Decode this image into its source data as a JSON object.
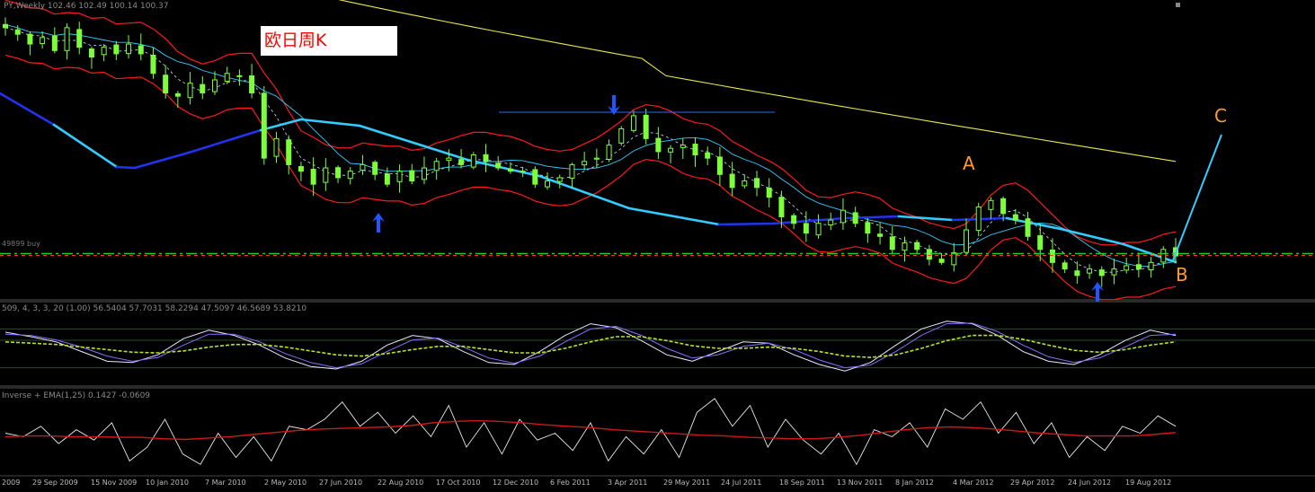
{
  "main_header": "PY,Weekly  102.46 102.49 100.14 100.37",
  "caption": "欧日周K",
  "hline_label": "49899 buy",
  "wave_labels": {
    "a": "A",
    "b": "B",
    "c": "C"
  },
  "stoch_header": "509, 4, 3, 3, 20 (1.00) 56.5404 57.7031 58.2294 47.5097 46.5689 53.8210",
  "inverse_header": "Inverse + EMA(1,25) 0.1427 -0.0609",
  "colors": {
    "background": "#000000",
    "bull_candle": "#7cff3a",
    "ma_cyan": "#33ccff",
    "ma_blue": "#2233ee",
    "ma_yellow": "#e6e64d",
    "band_red": "#ff1a1a",
    "arrow_blue": "#2255ff",
    "wave_label": "#ff9a33",
    "grid": "#2a3a2a"
  },
  "chart_data": [
    {
      "type": "candlestick",
      "title": "",
      "timeframe": "Weekly",
      "x_tick_labels": [
        "2009",
        "29 Sep 2009",
        "15 Nov 2009",
        "10 Jan 2010",
        "7 Mar 2010",
        "2 May 2010",
        "27 Jun 2010",
        "22 Aug 2010",
        "17 Oct 2010",
        "12 Dec 2010",
        "6 Feb 2011",
        "3 Apr 2011",
        "29 May 2011",
        "24 Jul 2011",
        "18 Sep 2011",
        "13 Nov 2011",
        "8 Jan 2012",
        "4 Mar 2012",
        "29 Apr 2012",
        "24 Jun 2012",
        "19 Aug 2012"
      ],
      "close_path": [
        134.5,
        133.5,
        132.0,
        133.0,
        131.0,
        134.5,
        131.5,
        130.0,
        131.5,
        130.5,
        132.0,
        130.5,
        127.5,
        124.5,
        124.0,
        126.0,
        124.5,
        126.5,
        127.5,
        127.0,
        124.5,
        114.5,
        117.5,
        113.5,
        112.5,
        110.5,
        113.0,
        111.5,
        112.5,
        113.5,
        112.0,
        110.5,
        112.5,
        111.0,
        113.0,
        114.0,
        114.5,
        113.5,
        115.0,
        114.0,
        113.0,
        112.5,
        112.5,
        110.5,
        111.0,
        111.5,
        113.5,
        114.0,
        114.5,
        116.5,
        119.0,
        121.0,
        117.5,
        115.5,
        116.0,
        116.5,
        115.0,
        114.5,
        112.0,
        110.0,
        111.0,
        110.0,
        108.5,
        105.5,
        104.5,
        103.0,
        104.5,
        105.0,
        106.5,
        104.5,
        103.0,
        102.5,
        100.5,
        101.5,
        100.5,
        99.0,
        98.5,
        100.0,
        103.5,
        107.0,
        108.0,
        106.0,
        105.0,
        102.5,
        100.5,
        98.5,
        97.5,
        96.5,
        97.5,
        96.5,
        97.5,
        98.0,
        97.5,
        98.5,
        100.5,
        99.5
      ],
      "events": {
        "high_arrow": {
          "date": "3 Apr 2011",
          "direction": "down"
        },
        "low_arrows": [
          {
            "date": "22 Aug 2010",
            "direction": "up"
          },
          {
            "date": "24 Jun 2012",
            "direction": "up"
          }
        ],
        "wave_points": [
          "A",
          "B",
          "C"
        ]
      },
      "indicators": [
        "Moving averages (cyan, blue, yellow)",
        "Red envelope bands",
        "Horizontal buy level (dash-dot)"
      ],
      "grid": false,
      "legend": "none"
    },
    {
      "type": "line",
      "title": "",
      "indicator": "Stochastic",
      "params": [
        509,
        4,
        3,
        3,
        20,
        1.0
      ],
      "values_shown": [
        56.5404,
        57.7031,
        58.2294,
        47.5097,
        46.5689,
        53.821
      ],
      "series": [
        {
          "name": "fast",
          "values": [
            75,
            68,
            60,
            45,
            30,
            28,
            40,
            65,
            78,
            70,
            55,
            35,
            22,
            18,
            30,
            55,
            70,
            65,
            45,
            28,
            25,
            45,
            70,
            88,
            82,
            62,
            40,
            30,
            45,
            60,
            58,
            40,
            25,
            15,
            28,
            55,
            80,
            92,
            88,
            70,
            45,
            30,
            25,
            40,
            62,
            78,
            70
          ]
        },
        {
          "name": "slow",
          "values": [
            72,
            70,
            63,
            52,
            38,
            30,
            36,
            55,
            72,
            72,
            60,
            42,
            28,
            20,
            26,
            45,
            63,
            66,
            52,
            35,
            27,
            38,
            60,
            80,
            84,
            70,
            50,
            35,
            40,
            53,
            58,
            48,
            32,
            20,
            24,
            45,
            70,
            88,
            89,
            76,
            55,
            37,
            28,
            35,
            52,
            70,
            72
          ]
        },
        {
          "name": "signal",
          "values": [
            60,
            58,
            56,
            52,
            48,
            44,
            43,
            46,
            52,
            56,
            56,
            52,
            46,
            40,
            38,
            42,
            48,
            53,
            53,
            48,
            43,
            43,
            50,
            60,
            68,
            68,
            62,
            54,
            50,
            50,
            52,
            50,
            45,
            38,
            36,
            40,
            50,
            62,
            70,
            70,
            64,
            55,
            47,
            44,
            48,
            55,
            60
          ]
        }
      ],
      "levels": [
        80,
        20
      ],
      "ylim": [
        0,
        100
      ]
    },
    {
      "type": "line",
      "title": "",
      "indicator": "Inverse + EMA",
      "params": [
        1,
        25
      ],
      "values_shown": [
        0.1427,
        -0.0609
      ],
      "series": [
        {
          "name": "inverse",
          "values": [
            0.1,
            0.05,
            0.2,
            -0.05,
            0.15,
            0.0,
            0.25,
            -0.3,
            -0.1,
            0.3,
            -0.2,
            -0.35,
            0.1,
            -0.25,
            0.05,
            -0.3,
            0.2,
            0.15,
            0.3,
            0.55,
            0.2,
            0.4,
            0.1,
            0.35,
            0.05,
            0.5,
            -0.1,
            0.25,
            -0.2,
            0.3,
            0.0,
            0.1,
            -0.15,
            0.25,
            -0.3,
            0.05,
            -0.2,
            0.15,
            -0.25,
            0.4,
            0.6,
            0.2,
            0.5,
            -0.1,
            0.3,
            0.0,
            -0.2,
            0.1,
            -0.35,
            0.15,
            0.05,
            0.25,
            -0.1,
            0.45,
            0.3,
            0.55,
            0.1,
            0.4,
            -0.05,
            0.25,
            -0.25,
            0.05,
            -0.15,
            0.2,
            0.1,
            0.35,
            0.2
          ]
        },
        {
          "name": "ema",
          "values": [
            0.05,
            0.06,
            0.06,
            0.05,
            0.05,
            0.04,
            0.04,
            0.02,
            0.01,
            0.03,
            0.05,
            0.08,
            0.11,
            0.14,
            0.16,
            0.17,
            0.18,
            0.19,
            0.21,
            0.25,
            0.27,
            0.28,
            0.27,
            0.25,
            0.22,
            0.2,
            0.18,
            0.15,
            0.13,
            0.11,
            0.09,
            0.07,
            0.06,
            0.04,
            0.03,
            0.02,
            0.02,
            0.04,
            0.07,
            0.11,
            0.15,
            0.18,
            0.19,
            0.18,
            0.16,
            0.13,
            0.1,
            0.08,
            0.06,
            0.06,
            0.06,
            0.08,
            0.11
          ]
        }
      ],
      "grid": false
    }
  ]
}
